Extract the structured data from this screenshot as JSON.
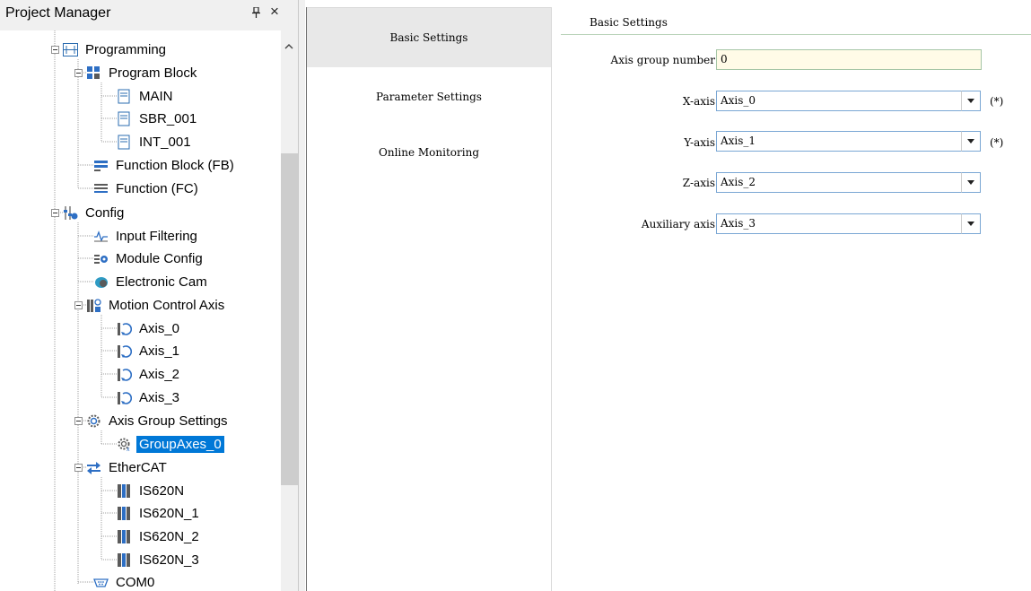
{
  "project_manager": {
    "title": "Project Manager",
    "pin_icon": "pin-icon",
    "close_label": "×",
    "tree": {
      "programming": "Programming",
      "program_block": "Program Block",
      "main": "MAIN",
      "sbr_001": "SBR_001",
      "int_001": "INT_001",
      "function_block": "Function Block (FB)",
      "function": "Function (FC)",
      "config": "Config",
      "input_filtering": "Input Filtering",
      "module_config": "Module Config",
      "electronic_cam": "Electronic Cam",
      "motion_control_axis": "Motion Control Axis",
      "axis_0": "Axis_0",
      "axis_1": "Axis_1",
      "axis_2": "Axis_2",
      "axis_3": "Axis_3",
      "axis_group_settings": "Axis Group Settings",
      "group_axes_0": "GroupAxes_0",
      "ethercat": "EtherCAT",
      "is620n": "IS620N",
      "is620n_1": "IS620N_1",
      "is620n_2": "IS620N_2",
      "is620n_3": "IS620N_3",
      "com0": "COM0"
    }
  },
  "nav": {
    "basic_settings": "Basic Settings",
    "parameter_settings": "Parameter Settings",
    "online_monitoring": "Online Monitoring"
  },
  "content": {
    "section_title": "Basic Settings",
    "axis_group_number_label": "Axis group number",
    "axis_group_number_value": "0",
    "x_axis_label": "X-axis",
    "x_axis_value": "Axis_0",
    "y_axis_label": "Y-axis",
    "y_axis_value": "Axis_1",
    "z_axis_label": "Z-axis",
    "z_axis_value": "Axis_2",
    "aux_axis_label": "Auxiliary axis",
    "aux_axis_value": "Axis_3",
    "required_mark": "(*)"
  },
  "colors": {
    "selection": "#0078d7",
    "active_tab": "#e8e8e8",
    "number_field_bg": "#fffbe7"
  }
}
